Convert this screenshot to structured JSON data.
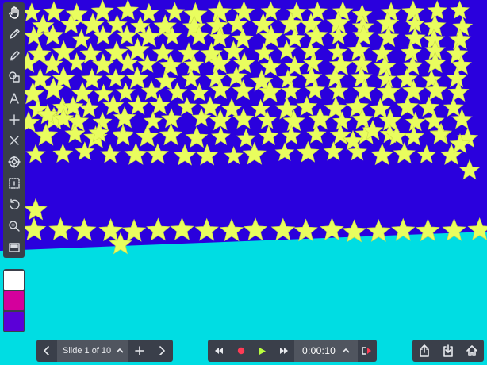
{
  "canvas": {
    "colors": {
      "background": "#00dde3",
      "band": "#2a00dd",
      "star": "#e9fd5e",
      "star_outline": "#cfe04a"
    }
  },
  "toolbar": {
    "tools": [
      {
        "name": "hand-icon",
        "label": "Hand"
      },
      {
        "name": "pen-icon",
        "label": "Pen"
      },
      {
        "name": "highlighter-icon",
        "label": "Highlighter"
      },
      {
        "name": "shapes-icon",
        "label": "Shapes"
      },
      {
        "name": "text-icon",
        "label": "Text"
      },
      {
        "name": "line-icon",
        "label": "Line"
      },
      {
        "name": "eraser-x-icon",
        "label": "Erase"
      },
      {
        "name": "target-icon",
        "label": "Pointer"
      },
      {
        "name": "select-icon",
        "label": "Select"
      },
      {
        "name": "undo-icon",
        "label": "Undo"
      },
      {
        "name": "zoom-icon",
        "label": "Zoom"
      },
      {
        "name": "slide-view-icon",
        "label": "View"
      }
    ]
  },
  "swatches": [
    "#ffffff",
    "#d4009c",
    "#5b00d8"
  ],
  "slide_nav": {
    "label": "Slide 1 of 10"
  },
  "playback": {
    "time": "0:00:10",
    "record_color": "#ff3b55",
    "play_color": "#b9ff3d"
  }
}
